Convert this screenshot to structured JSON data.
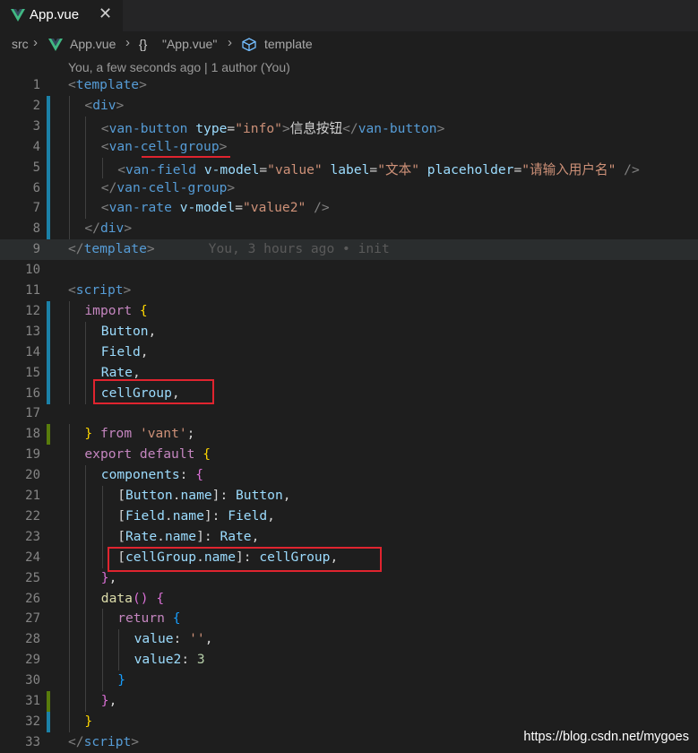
{
  "tab": {
    "label": "App.vue",
    "close": "✕"
  },
  "breadcrumb": {
    "src": "src",
    "file": "App.vue",
    "obj": "\"App.vue\"",
    "obj_icon": "{}",
    "template": "template"
  },
  "codelens": "You, a few seconds ago | 1 author (You)",
  "blame_line9": "You, 3 hours ago • init",
  "watermark": "https://blog.csdn.net/mygoes",
  "colors": {
    "added_bar": "#1b81a8",
    "modified_bar": "#587c0c",
    "red_annotation": "#e0242f"
  },
  "lines": [
    {
      "n": "1",
      "gutter": "",
      "indent": 0,
      "tokens": [
        [
          "t-punc",
          "<"
        ],
        [
          "t-tag",
          "template"
        ],
        [
          "t-punc",
          ">"
        ]
      ]
    },
    {
      "n": "2",
      "gutter": "added",
      "indent": 1,
      "tokens": [
        [
          "t-punc",
          "<"
        ],
        [
          "t-tag",
          "div"
        ],
        [
          "t-punc",
          ">"
        ]
      ]
    },
    {
      "n": "3",
      "gutter": "added",
      "indent": 2,
      "tokens": [
        [
          "t-punc",
          "<"
        ],
        [
          "t-tag",
          "van-button"
        ],
        [
          "t-plain",
          " "
        ],
        [
          "t-attr",
          "type"
        ],
        [
          "t-plain",
          "="
        ],
        [
          "t-str",
          "\"info\""
        ],
        [
          "t-punc",
          ">"
        ],
        [
          "t-plain",
          "信息按钮"
        ],
        [
          "t-punc",
          "</"
        ],
        [
          "t-tag",
          "van-button"
        ],
        [
          "t-punc",
          ">"
        ]
      ]
    },
    {
      "n": "4",
      "gutter": "added",
      "indent": 2,
      "tokens": [
        [
          "t-punc",
          "<"
        ],
        [
          "t-tag",
          "van-cell-group"
        ],
        [
          "t-punc",
          ">"
        ]
      ]
    },
    {
      "n": "5",
      "gutter": "added",
      "indent": 3,
      "tokens": [
        [
          "t-punc",
          "<"
        ],
        [
          "t-tag",
          "van-field"
        ],
        [
          "t-plain",
          " "
        ],
        [
          "t-attr",
          "v-model"
        ],
        [
          "t-plain",
          "="
        ],
        [
          "t-str",
          "\"value\""
        ],
        [
          "t-plain",
          " "
        ],
        [
          "t-attr",
          "label"
        ],
        [
          "t-plain",
          "="
        ],
        [
          "t-str",
          "\"文本\""
        ],
        [
          "t-plain",
          " "
        ],
        [
          "t-attr",
          "placeholder"
        ],
        [
          "t-plain",
          "="
        ],
        [
          "t-str",
          "\"请输入用户名\""
        ],
        [
          "t-plain",
          " "
        ],
        [
          "t-punc",
          "/>"
        ]
      ]
    },
    {
      "n": "6",
      "gutter": "added",
      "indent": 2,
      "tokens": [
        [
          "t-punc",
          "</"
        ],
        [
          "t-tag",
          "van-cell-group"
        ],
        [
          "t-punc",
          ">"
        ]
      ]
    },
    {
      "n": "7",
      "gutter": "added",
      "indent": 2,
      "tokens": [
        [
          "t-punc",
          "<"
        ],
        [
          "t-tag",
          "van-rate"
        ],
        [
          "t-plain",
          " "
        ],
        [
          "t-attr",
          "v-model"
        ],
        [
          "t-plain",
          "="
        ],
        [
          "t-str",
          "\"value2\""
        ],
        [
          "t-plain",
          " "
        ],
        [
          "t-punc",
          "/>"
        ]
      ]
    },
    {
      "n": "8",
      "gutter": "added",
      "indent": 1,
      "tokens": [
        [
          "t-punc",
          "</"
        ],
        [
          "t-tag",
          "div"
        ],
        [
          "t-punc",
          ">"
        ]
      ]
    },
    {
      "n": "9",
      "gutter": "",
      "indent": 0,
      "tokens": [
        [
          "t-punc",
          "</"
        ],
        [
          "t-tag",
          "template"
        ],
        [
          "t-punc",
          ">"
        ]
      ]
    },
    {
      "n": "10",
      "gutter": "",
      "indent": 0,
      "tokens": []
    },
    {
      "n": "11",
      "gutter": "",
      "indent": 0,
      "tokens": [
        [
          "t-punc",
          "<"
        ],
        [
          "t-tag",
          "script"
        ],
        [
          "t-punc",
          ">"
        ]
      ]
    },
    {
      "n": "12",
      "gutter": "added",
      "indent": 1,
      "tokens": [
        [
          "t-kw",
          "import"
        ],
        [
          "t-plain",
          " "
        ],
        [
          "t-brace1",
          "{"
        ]
      ]
    },
    {
      "n": "13",
      "gutter": "added",
      "indent": 2,
      "tokens": [
        [
          "t-var",
          "Button"
        ],
        [
          "t-plain",
          ","
        ]
      ]
    },
    {
      "n": "14",
      "gutter": "added",
      "indent": 2,
      "tokens": [
        [
          "t-var",
          "Field"
        ],
        [
          "t-plain",
          ","
        ]
      ]
    },
    {
      "n": "15",
      "gutter": "added",
      "indent": 2,
      "tokens": [
        [
          "t-var",
          "Rate"
        ],
        [
          "t-plain",
          ","
        ]
      ]
    },
    {
      "n": "16",
      "gutter": "added",
      "indent": 2,
      "tokens": [
        [
          "t-var",
          "cellGroup"
        ],
        [
          "t-plain",
          ","
        ]
      ]
    },
    {
      "n": "17",
      "gutter": "",
      "indent": 0,
      "tokens": []
    },
    {
      "n": "18",
      "gutter": "modified",
      "indent": 1,
      "tokens": [
        [
          "t-brace1",
          "}"
        ],
        [
          "t-plain",
          " "
        ],
        [
          "t-kw",
          "from"
        ],
        [
          "t-plain",
          " "
        ],
        [
          "t-str",
          "'vant'"
        ],
        [
          "t-plain",
          ";"
        ]
      ]
    },
    {
      "n": "19",
      "gutter": "",
      "indent": 1,
      "tokens": [
        [
          "t-kw",
          "export"
        ],
        [
          "t-plain",
          " "
        ],
        [
          "t-kw",
          "default"
        ],
        [
          "t-plain",
          " "
        ],
        [
          "t-brace1",
          "{"
        ]
      ]
    },
    {
      "n": "20",
      "gutter": "",
      "indent": 2,
      "tokens": [
        [
          "t-var",
          "components"
        ],
        [
          "t-plain",
          ": "
        ],
        [
          "t-brace2",
          "{"
        ]
      ]
    },
    {
      "n": "21",
      "gutter": "",
      "indent": 3,
      "tokens": [
        [
          "t-plain",
          "["
        ],
        [
          "t-var",
          "Button"
        ],
        [
          "t-plain",
          "."
        ],
        [
          "t-var",
          "name"
        ],
        [
          "t-plain",
          "]: "
        ],
        [
          "t-var",
          "Button"
        ],
        [
          "t-plain",
          ","
        ]
      ]
    },
    {
      "n": "22",
      "gutter": "",
      "indent": 3,
      "tokens": [
        [
          "t-plain",
          "["
        ],
        [
          "t-var",
          "Field"
        ],
        [
          "t-plain",
          "."
        ],
        [
          "t-var",
          "name"
        ],
        [
          "t-plain",
          "]: "
        ],
        [
          "t-var",
          "Field"
        ],
        [
          "t-plain",
          ","
        ]
      ]
    },
    {
      "n": "23",
      "gutter": "",
      "indent": 3,
      "tokens": [
        [
          "t-plain",
          "["
        ],
        [
          "t-var",
          "Rate"
        ],
        [
          "t-plain",
          "."
        ],
        [
          "t-var",
          "name"
        ],
        [
          "t-plain",
          "]: "
        ],
        [
          "t-var",
          "Rate"
        ],
        [
          "t-plain",
          ","
        ]
      ]
    },
    {
      "n": "24",
      "gutter": "",
      "indent": 3,
      "tokens": [
        [
          "t-plain",
          "["
        ],
        [
          "t-var",
          "cellGroup"
        ],
        [
          "t-plain",
          "."
        ],
        [
          "t-var",
          "name"
        ],
        [
          "t-plain",
          "]: "
        ],
        [
          "t-var",
          "cellGroup"
        ],
        [
          "t-plain",
          ","
        ]
      ]
    },
    {
      "n": "25",
      "gutter": "",
      "indent": 2,
      "tokens": [
        [
          "t-brace2",
          "}"
        ],
        [
          "t-plain",
          ","
        ]
      ]
    },
    {
      "n": "26",
      "gutter": "",
      "indent": 2,
      "tokens": [
        [
          "t-fn",
          "data"
        ],
        [
          "t-brace2",
          "()"
        ],
        [
          "t-plain",
          " "
        ],
        [
          "t-brace2",
          "{"
        ]
      ]
    },
    {
      "n": "27",
      "gutter": "",
      "indent": 3,
      "tokens": [
        [
          "t-kw",
          "return"
        ],
        [
          "t-plain",
          " "
        ],
        [
          "t-brace3",
          "{"
        ]
      ]
    },
    {
      "n": "28",
      "gutter": "",
      "indent": 4,
      "tokens": [
        [
          "t-var",
          "value"
        ],
        [
          "t-plain",
          ": "
        ],
        [
          "t-str",
          "''"
        ],
        [
          "t-plain",
          ","
        ]
      ]
    },
    {
      "n": "29",
      "gutter": "",
      "indent": 4,
      "tokens": [
        [
          "t-var",
          "value2"
        ],
        [
          "t-plain",
          ": "
        ],
        [
          "t-num",
          "3"
        ]
      ]
    },
    {
      "n": "30",
      "gutter": "",
      "indent": 3,
      "tokens": [
        [
          "t-brace3",
          "}"
        ]
      ]
    },
    {
      "n": "31",
      "gutter": "modified",
      "indent": 2,
      "tokens": [
        [
          "t-brace2",
          "}"
        ],
        [
          "t-plain",
          ","
        ]
      ]
    },
    {
      "n": "32",
      "gutter": "added",
      "indent": 1,
      "tokens": [
        [
          "t-brace1",
          "}"
        ]
      ]
    },
    {
      "n": "33",
      "gutter": "",
      "indent": 0,
      "tokens": [
        [
          "t-punc",
          "</"
        ],
        [
          "t-tag",
          "script"
        ],
        [
          "t-punc",
          ">"
        ]
      ]
    }
  ]
}
